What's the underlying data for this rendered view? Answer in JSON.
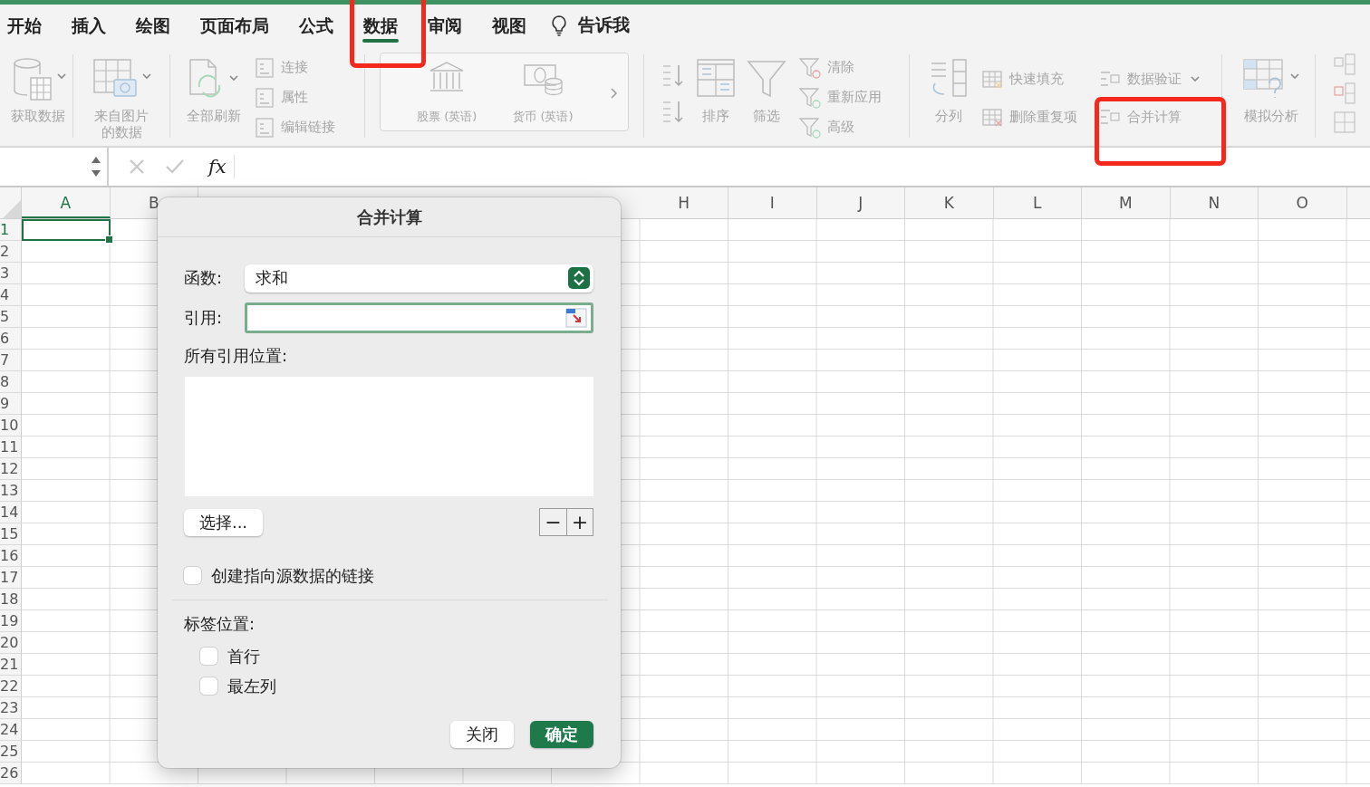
{
  "tabs": [
    {
      "label": "开始",
      "selected": false
    },
    {
      "label": "插入",
      "selected": false
    },
    {
      "label": "绘图",
      "selected": false
    },
    {
      "label": "页面布局",
      "selected": false
    },
    {
      "label": "公式",
      "selected": false
    },
    {
      "label": "数据",
      "selected": true
    },
    {
      "label": "审阅",
      "selected": false
    },
    {
      "label": "视图",
      "selected": false
    }
  ],
  "tell_me": "告诉我",
  "ribbon": {
    "disabled": true,
    "get_data": "获取数据",
    "from_picture": "来自图片的数据",
    "refresh_all": "全部刷新",
    "connections": [
      "连接",
      "属性",
      "编辑链接"
    ],
    "data_types": [
      "股票 (英语)",
      "货币 (英语)"
    ],
    "sort": "排序",
    "filter": "筛选",
    "filter_actions": [
      "清除",
      "重新应用",
      "高级"
    ],
    "text_to_columns": "分列",
    "data_tools": [
      "快速填充",
      "删除重复项"
    ],
    "validation": [
      "数据验证",
      "合并计算"
    ],
    "what_if": "模拟分析"
  },
  "formula_bar": {
    "fx": "fx"
  },
  "columns": [
    {
      "label": "A",
      "selected": true
    },
    {
      "label": "B",
      "selected": false
    },
    {
      "label": "H",
      "selected": false
    },
    {
      "label": "I",
      "selected": false
    },
    {
      "label": "J",
      "selected": false
    },
    {
      "label": "K",
      "selected": false
    },
    {
      "label": "L",
      "selected": false
    },
    {
      "label": "M",
      "selected": false
    },
    {
      "label": "N",
      "selected": false
    },
    {
      "label": "O",
      "selected": false
    }
  ],
  "rows": [
    {
      "label": "1",
      "selected": true
    },
    {
      "label": "2",
      "selected": false
    },
    {
      "label": "3",
      "selected": false
    },
    {
      "label": "4",
      "selected": false
    },
    {
      "label": "5",
      "selected": false
    },
    {
      "label": "6",
      "selected": false
    },
    {
      "label": "7",
      "selected": false
    },
    {
      "label": "8",
      "selected": false
    },
    {
      "label": "9",
      "selected": false
    },
    {
      "label": "10",
      "selected": false
    },
    {
      "label": "11",
      "selected": false
    },
    {
      "label": "12",
      "selected": false
    },
    {
      "label": "13",
      "selected": false
    },
    {
      "label": "14",
      "selected": false
    },
    {
      "label": "15",
      "selected": false
    },
    {
      "label": "16",
      "selected": false
    },
    {
      "label": "17",
      "selected": false
    },
    {
      "label": "18",
      "selected": false
    },
    {
      "label": "19",
      "selected": false
    },
    {
      "label": "20",
      "selected": false
    },
    {
      "label": "21",
      "selected": false
    },
    {
      "label": "22",
      "selected": false
    },
    {
      "label": "23",
      "selected": false
    },
    {
      "label": "24",
      "selected": false
    },
    {
      "label": "25",
      "selected": false
    },
    {
      "label": "26",
      "selected": false
    }
  ],
  "dialog": {
    "title": "合并计算",
    "function_label": "函数:",
    "function_value": "求和",
    "reference_label": "引用:",
    "reference_focused": true,
    "all_references_label": "所有引用位置:",
    "browse_button": "选择...",
    "remove_button": "−",
    "add_button": "+",
    "create_links": {
      "label": "创建指向源数据的链接",
      "checked": false
    },
    "labels_title": "标签位置:",
    "label_options": [
      {
        "label": "首行",
        "checked": false
      },
      {
        "label": "最左列",
        "checked": false
      }
    ],
    "buttons": [
      {
        "label": "关闭",
        "default": false
      },
      {
        "label": "确定",
        "default": true
      }
    ]
  }
}
